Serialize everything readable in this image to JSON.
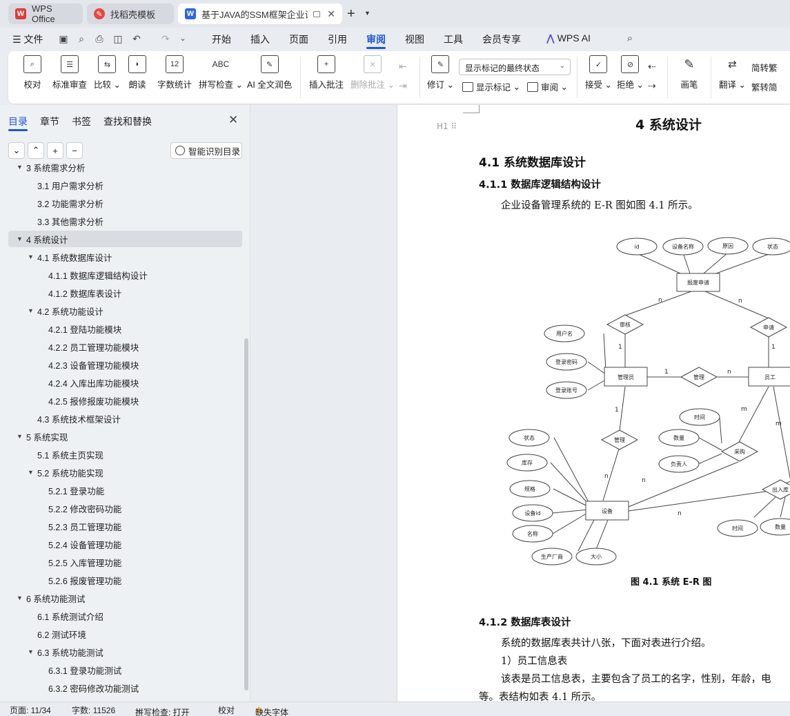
{
  "tabs": [
    {
      "label": "WPS Office",
      "icon": "wps-icon"
    },
    {
      "label": "找稻壳模板",
      "icon": "docer-icon"
    },
    {
      "label": "基于JAVA的SSM框架企业设备",
      "icon": "word-doc-icon"
    }
  ],
  "menu": {
    "file": "文件",
    "items": [
      "开始",
      "插入",
      "页面",
      "引用",
      "审阅",
      "视图",
      "工具",
      "会员专享"
    ],
    "active": "审阅",
    "ai": "WPS AI"
  },
  "ribbon": {
    "proofread": "校对",
    "standard_review": "标准审查",
    "compare": "比较",
    "read_aloud": "朗读",
    "word_count": "字数统计",
    "spell_check": "拼写检查",
    "ai_polish": "AI 全文润色",
    "insert_comment": "插入批注",
    "delete_comment": "删除批注",
    "revise": "修订",
    "markup_mode": "显示标记的最终状态",
    "show_markup": "显示标记",
    "review": "审阅",
    "accept": "接受",
    "reject": "拒绝",
    "pen": "画笔",
    "translate": "翻译",
    "to_traditional": "简转繁",
    "to_simplified": "繁转简",
    "trad_short": "转繁",
    "simp_short": "转简",
    "word_count_icon_text": "12",
    "spell_icon_text": "ABC"
  },
  "panel": {
    "tabs": [
      "目录",
      "章节",
      "书签",
      "查找和替换"
    ],
    "smart_toc": "智能识别目录",
    "toc": [
      {
        "text": "3  系统需求分析",
        "level": 1,
        "caret": true
      },
      {
        "text": "3.1  用户需求分析",
        "level": 2
      },
      {
        "text": "3.2  功能需求分析",
        "level": 2
      },
      {
        "text": "3.3  其他需求分析",
        "level": 2
      },
      {
        "text": "4  系统设计",
        "level": 1,
        "caret": true,
        "selected": true
      },
      {
        "text": "4.1  系统数据库设计",
        "level": 2,
        "caret": true
      },
      {
        "text": "4.1.1  数据库逻辑结构设计",
        "level": 3
      },
      {
        "text": "4.1.2  数据库表设计",
        "level": 3
      },
      {
        "text": "4.2  系统功能设计",
        "level": 2,
        "caret": true
      },
      {
        "text": "4.2.1  登陆功能模块",
        "level": 3
      },
      {
        "text": "4.2.2  员工管理功能模块",
        "level": 3
      },
      {
        "text": "4.2.3  设备管理功能模块",
        "level": 3
      },
      {
        "text": "4.2.4  入库出库功能模块",
        "level": 3
      },
      {
        "text": "4.2.5  报修报废功能模块",
        "level": 3
      },
      {
        "text": "4.3  系统技术框架设计",
        "level": 2
      },
      {
        "text": "5  系统实现",
        "level": 1,
        "caret": true
      },
      {
        "text": "5.1  系统主页实现",
        "level": 2
      },
      {
        "text": "5.2  系统功能实现",
        "level": 2,
        "caret": true
      },
      {
        "text": "5.2.1  登录功能",
        "level": 3
      },
      {
        "text": "5.2.2  修改密码功能",
        "level": 3
      },
      {
        "text": "5.2.3  员工管理功能",
        "level": 3
      },
      {
        "text": "5.2.4  设备管理功能",
        "level": 3
      },
      {
        "text": "5.2.5  入库管理功能",
        "level": 3
      },
      {
        "text": "5.2.6  报废管理功能",
        "level": 3
      },
      {
        "text": "6  系统功能测试",
        "level": 1,
        "caret": true
      },
      {
        "text": "6.1  系统测试介绍",
        "level": 2
      },
      {
        "text": "6.2  测试环境",
        "level": 2
      },
      {
        "text": "6.3  系统功能测试",
        "level": 2,
        "caret": true
      },
      {
        "text": "6.3.1  登录功能测试",
        "level": 3
      },
      {
        "text": "6.3.2  密码修改功能测试",
        "level": 3
      }
    ]
  },
  "document": {
    "heading_marker": "H1",
    "chapter_title": "4  系统设计",
    "section_title": "4.1  系统数据库设计",
    "subsection_1": "4.1.1  数据库逻辑结构设计",
    "para_1": "企业设备管理系统的 E-R 图如图 4.1 所示。",
    "figure_caption": "图 4.1  系统 E-R 图",
    "subsection_2": "4.1.2  数据库表设计",
    "para_2": "系统的数据库表共计八张，下面对表进行介绍。",
    "para_3": "1）员工信息表",
    "para_4": "该表是员工信息表，主要包含了员工的名字，性别，年龄，电",
    "para_5": "等。表结构如表 4.1 所示。",
    "er_labels": {
      "id": "id",
      "device_name": "设备名称",
      "reason": "原因",
      "state_top": "状态",
      "scrap_request": "报废申请",
      "review": "审核",
      "apply": "申请",
      "username": "用户名",
      "login_password": "登录密码",
      "login_account": "登录账号",
      "admin": "管理员",
      "manage_rel": "管理",
      "employee": "员工",
      "time_purchase": "时间",
      "quantity_purchase": "数量",
      "person_in_charge": "负责人",
      "purchase": "采购",
      "manage_dev": "管理",
      "state": "状态",
      "stock": "库存",
      "spec": "规格",
      "device_id": "设备id",
      "name": "名称",
      "manufacturer": "生产厂商",
      "size": "大小",
      "device": "设备",
      "in_out": "出入库",
      "time_inout": "时间",
      "quantity_inout": "数量",
      "n": "n",
      "one": "1",
      "m": "m"
    }
  },
  "status": {
    "page": "页面: 11/34",
    "words": "字数: 11526",
    "spell": "拼写检查: 打开",
    "proof": "校对",
    "missing_font": "缺失字体"
  }
}
